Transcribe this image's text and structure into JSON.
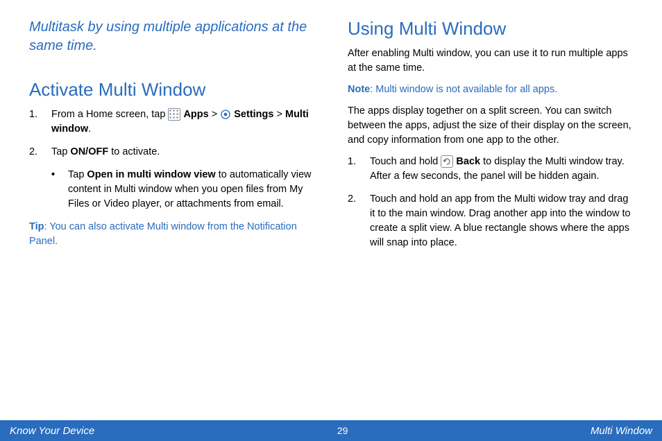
{
  "intro": "Multitask by using multiple applications at the same time.",
  "left": {
    "heading": "Activate Multi Window",
    "step1_pre": "From a Home screen, tap ",
    "step1_apps": "Apps",
    "step1_gt1": " > ",
    "step1_settings": "Settings",
    "step1_gt2": " > ",
    "step1_mw": "Multi window",
    "step1_end": ".",
    "step2_pre": "Tap ",
    "step2_onoff": "ON/OFF",
    "step2_post": " to activate.",
    "bullet_pre": "Tap ",
    "bullet_bold": "Open in multi window view",
    "bullet_post": " to automatically view content in Multi window when you open files from My Files or Video player, or attachments from email.",
    "tip_label": "Tip",
    "tip_text": ": You can also activate Multi window from the Notification Panel."
  },
  "right": {
    "heading": "Using Multi Window",
    "p1": "After enabling Multi window, you can use it to run multiple apps at the same time.",
    "note_label": "Note",
    "note_text": ": Multi window is not available for all apps.",
    "p2": "The apps display together on a split screen. You can switch between the apps, adjust the size of their display on the screen, and copy information from one app to the other.",
    "step1_pre": "Touch and hold ",
    "step1_back": "Back",
    "step1_post": " to display the Multi window tray. After a few seconds, the panel will be hidden again.",
    "step2": "Touch and hold an app from the Multi widow tray and drag it to the main window. Drag another app into the window to create a split view. A blue rectangle shows where the apps will snap into place."
  },
  "footer": {
    "left": "Know Your Device",
    "page": "29",
    "right": "Multi Window"
  },
  "nums": {
    "one": "1.",
    "two": "2."
  },
  "bullet_char": "•"
}
